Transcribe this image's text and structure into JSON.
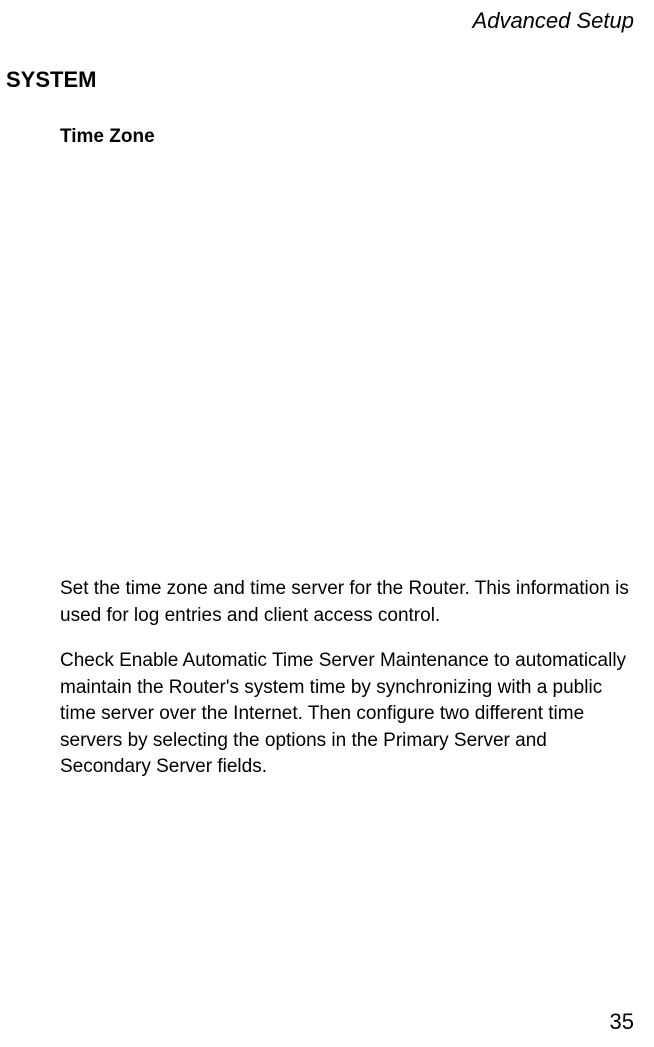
{
  "header": {
    "title": "Advanced Setup"
  },
  "content": {
    "section_heading": "SYSTEM",
    "sub_heading": "Time Zone",
    "paragraph1": "Set the time zone and time server for the Router. This information is used for log entries and client access control.",
    "paragraph2": "Check Enable Automatic Time Server Maintenance to automatically maintain the Router's system time by synchronizing with a public time server over the Internet. Then configure two different time servers by selecting the options in the Primary Server and Secondary Server fields."
  },
  "footer": {
    "page_number": "35"
  }
}
